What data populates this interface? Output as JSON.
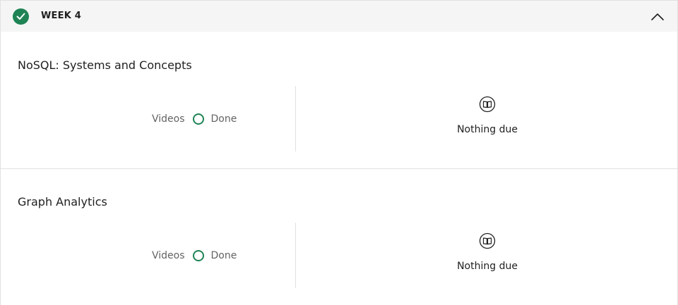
{
  "week": {
    "title": "WEEK 4",
    "status_icon": "check-circle-icon",
    "toggle_icon": "chevron-up-icon",
    "accent_color": "#1f8354"
  },
  "modules": [
    {
      "title": "NoSQL: Systems and Concepts",
      "progress_label": "Videos",
      "progress_status": "Done",
      "due_icon": "book-icon",
      "due_text": "Nothing due"
    },
    {
      "title": "Graph Analytics",
      "progress_label": "Videos",
      "progress_status": "Done",
      "due_icon": "book-icon",
      "due_text": "Nothing due"
    }
  ]
}
